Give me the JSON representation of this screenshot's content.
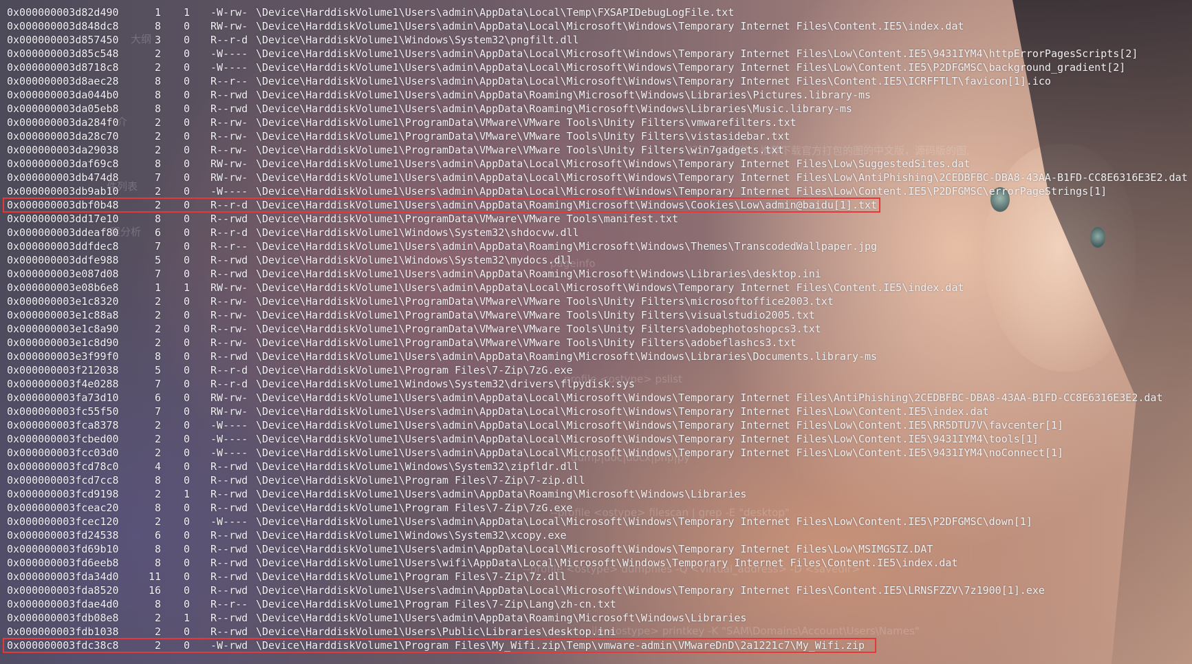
{
  "background_ghost_text": [
    "大纲",
    "介",
    "件列表",
    "程分析",
    "pageinfo",
    "行了一下安装，推荐下载官方打包的图的中文版，源码版的图,",
    "profile <ostype> pslist",
    "dump|doc|docx|php|py",
    "--profile <ostype> filescan | grep -E \"desktop\"",
    "--profile <ostype> dumpfiles -Q <virtual_address> -D <savedir>",
    "ile <ostype> printkey -K \"SAM\\Domains\\Account\\Users\\Names\""
  ],
  "rows": [
    {
      "off": "0x000000003d82d490",
      "ptr": "1",
      "hnd": "1",
      "acc": "-W-rw-",
      "path": "\\Device\\HarddiskVolume1\\Users\\admin\\AppData\\Local\\Temp\\FXSAPIDebugLogFile.txt"
    },
    {
      "off": "0x000000003d848dc8",
      "ptr": "8",
      "hnd": "0",
      "acc": "RW-rw-",
      "path": "\\Device\\HarddiskVolume1\\Users\\admin\\AppData\\Local\\Microsoft\\Windows\\Temporary Internet Files\\Content.IE5\\index.dat"
    },
    {
      "off": "0x000000003d857450",
      "ptr": "3",
      "hnd": "0",
      "acc": "R--r-d",
      "path": "\\Device\\HarddiskVolume1\\Windows\\System32\\pngfilt.dll"
    },
    {
      "off": "0x000000003d85c548",
      "ptr": "2",
      "hnd": "0",
      "acc": "-W----",
      "path": "\\Device\\HarddiskVolume1\\Users\\admin\\AppData\\Local\\Microsoft\\Windows\\Temporary Internet Files\\Low\\Content.IE5\\9431IYM4\\httpErrorPagesScripts[2]"
    },
    {
      "off": "0x000000003d8718c8",
      "ptr": "2",
      "hnd": "0",
      "acc": "-W----",
      "path": "\\Device\\HarddiskVolume1\\Users\\admin\\AppData\\Local\\Microsoft\\Windows\\Temporary Internet Files\\Low\\Content.IE5\\P2DFGMSC\\background_gradient[2]"
    },
    {
      "off": "0x000000003d8aec28",
      "ptr": "8",
      "hnd": "0",
      "acc": "R--r--",
      "path": "\\Device\\HarddiskVolume1\\Users\\admin\\AppData\\Local\\Microsoft\\Windows\\Temporary Internet Files\\Content.IE5\\ICRFFTLT\\favicon[1].ico"
    },
    {
      "off": "0x000000003da044b0",
      "ptr": "8",
      "hnd": "0",
      "acc": "R--rwd",
      "path": "\\Device\\HarddiskVolume1\\Users\\admin\\AppData\\Roaming\\Microsoft\\Windows\\Libraries\\Pictures.library-ms"
    },
    {
      "off": "0x000000003da05eb8",
      "ptr": "8",
      "hnd": "0",
      "acc": "R--rwd",
      "path": "\\Device\\HarddiskVolume1\\Users\\admin\\AppData\\Roaming\\Microsoft\\Windows\\Libraries\\Music.library-ms"
    },
    {
      "off": "0x000000003da284f0",
      "ptr": "2",
      "hnd": "0",
      "acc": "R--rw-",
      "path": "\\Device\\HarddiskVolume1\\ProgramData\\VMware\\VMware Tools\\Unity Filters\\vmwarefilters.txt"
    },
    {
      "off": "0x000000003da28c70",
      "ptr": "2",
      "hnd": "0",
      "acc": "R--rw-",
      "path": "\\Device\\HarddiskVolume1\\ProgramData\\VMware\\VMware Tools\\Unity Filters\\vistasidebar.txt"
    },
    {
      "off": "0x000000003da29038",
      "ptr": "2",
      "hnd": "0",
      "acc": "R--rw-",
      "path": "\\Device\\HarddiskVolume1\\ProgramData\\VMware\\VMware Tools\\Unity Filters\\win7gadgets.txt"
    },
    {
      "off": "0x000000003daf69c8",
      "ptr": "8",
      "hnd": "0",
      "acc": "RW-rw-",
      "path": "\\Device\\HarddiskVolume1\\Users\\admin\\AppData\\Local\\Microsoft\\Windows\\Temporary Internet Files\\Low\\SuggestedSites.dat"
    },
    {
      "off": "0x000000003db474d8",
      "ptr": "7",
      "hnd": "0",
      "acc": "RW-rw-",
      "path": "\\Device\\HarddiskVolume1\\Users\\admin\\AppData\\Local\\Microsoft\\Windows\\Temporary Internet Files\\Low\\AntiPhishing\\2CEDBFBC-DBA8-43AA-B1FD-CC8E6316E3E2.dat"
    },
    {
      "off": "0x000000003db9ab10",
      "ptr": "2",
      "hnd": "0",
      "acc": "-W----",
      "path": "\\Device\\HarddiskVolume1\\Users\\admin\\AppData\\Local\\Microsoft\\Windows\\Temporary Internet Files\\Low\\Content.IE5\\P2DFGMSC\\errorPageStrings[1]"
    },
    {
      "off": "0x000000003dbf0b48",
      "ptr": "2",
      "hnd": "0",
      "acc": "R--r-d",
      "path": "\\Device\\HarddiskVolume1\\Users\\admin\\AppData\\Roaming\\Microsoft\\Windows\\Cookies\\Low\\admin@baidu[1].txt",
      "highlight": true
    },
    {
      "off": "0x000000003dd17e10",
      "ptr": "8",
      "hnd": "0",
      "acc": "R--rwd",
      "path": "\\Device\\HarddiskVolume1\\ProgramData\\VMware\\VMware Tools\\manifest.txt"
    },
    {
      "off": "0x000000003ddeaf80",
      "ptr": "6",
      "hnd": "0",
      "acc": "R--r-d",
      "path": "\\Device\\HarddiskVolume1\\Windows\\System32\\shdocvw.dll"
    },
    {
      "off": "0x000000003ddfdec8",
      "ptr": "7",
      "hnd": "0",
      "acc": "R--r--",
      "path": "\\Device\\HarddiskVolume1\\Users\\admin\\AppData\\Roaming\\Microsoft\\Windows\\Themes\\TranscodedWallpaper.jpg"
    },
    {
      "off": "0x000000003ddfe988",
      "ptr": "5",
      "hnd": "0",
      "acc": "R--rwd",
      "path": "\\Device\\HarddiskVolume1\\Windows\\System32\\mydocs.dll"
    },
    {
      "off": "0x000000003e087d08",
      "ptr": "7",
      "hnd": "0",
      "acc": "R--rwd",
      "path": "\\Device\\HarddiskVolume1\\Users\\admin\\AppData\\Roaming\\Microsoft\\Windows\\Libraries\\desktop.ini"
    },
    {
      "off": "0x000000003e08b6e8",
      "ptr": "1",
      "hnd": "1",
      "acc": "RW-rw-",
      "path": "\\Device\\HarddiskVolume1\\Users\\admin\\AppData\\Local\\Microsoft\\Windows\\Temporary Internet Files\\Content.IE5\\index.dat"
    },
    {
      "off": "0x000000003e1c8320",
      "ptr": "2",
      "hnd": "0",
      "acc": "R--rw-",
      "path": "\\Device\\HarddiskVolume1\\ProgramData\\VMware\\VMware Tools\\Unity Filters\\microsoftoffice2003.txt"
    },
    {
      "off": "0x000000003e1c88a8",
      "ptr": "2",
      "hnd": "0",
      "acc": "R--rw-",
      "path": "\\Device\\HarddiskVolume1\\ProgramData\\VMware\\VMware Tools\\Unity Filters\\visualstudio2005.txt"
    },
    {
      "off": "0x000000003e1c8a90",
      "ptr": "2",
      "hnd": "0",
      "acc": "R--rw-",
      "path": "\\Device\\HarddiskVolume1\\ProgramData\\VMware\\VMware Tools\\Unity Filters\\adobephotoshopcs3.txt"
    },
    {
      "off": "0x000000003e1c8d90",
      "ptr": "2",
      "hnd": "0",
      "acc": "R--rw-",
      "path": "\\Device\\HarddiskVolume1\\ProgramData\\VMware\\VMware Tools\\Unity Filters\\adobeflashcs3.txt"
    },
    {
      "off": "0x000000003e3f99f0",
      "ptr": "8",
      "hnd": "0",
      "acc": "R--rwd",
      "path": "\\Device\\HarddiskVolume1\\Users\\admin\\AppData\\Roaming\\Microsoft\\Windows\\Libraries\\Documents.library-ms"
    },
    {
      "off": "0x000000003f212038",
      "ptr": "5",
      "hnd": "0",
      "acc": "R--r-d",
      "path": "\\Device\\HarddiskVolume1\\Program Files\\7-Zip\\7zG.exe"
    },
    {
      "off": "0x000000003f4e0288",
      "ptr": "7",
      "hnd": "0",
      "acc": "R--r-d",
      "path": "\\Device\\HarddiskVolume1\\Windows\\System32\\drivers\\flpydisk.sys"
    },
    {
      "off": "0x000000003fa73d10",
      "ptr": "6",
      "hnd": "0",
      "acc": "RW-rw-",
      "path": "\\Device\\HarddiskVolume1\\Users\\admin\\AppData\\Local\\Microsoft\\Windows\\Temporary Internet Files\\AntiPhishing\\2CEDBFBC-DBA8-43AA-B1FD-CC8E6316E3E2.dat"
    },
    {
      "off": "0x000000003fc55f50",
      "ptr": "7",
      "hnd": "0",
      "acc": "RW-rw-",
      "path": "\\Device\\HarddiskVolume1\\Users\\admin\\AppData\\Local\\Microsoft\\Windows\\Temporary Internet Files\\Low\\Content.IE5\\index.dat"
    },
    {
      "off": "0x000000003fca8378",
      "ptr": "2",
      "hnd": "0",
      "acc": "-W----",
      "path": "\\Device\\HarddiskVolume1\\Users\\admin\\AppData\\Local\\Microsoft\\Windows\\Temporary Internet Files\\Low\\Content.IE5\\RR5DTU7V\\favcenter[1]"
    },
    {
      "off": "0x000000003fcbed00",
      "ptr": "2",
      "hnd": "0",
      "acc": "-W----",
      "path": "\\Device\\HarddiskVolume1\\Users\\admin\\AppData\\Local\\Microsoft\\Windows\\Temporary Internet Files\\Low\\Content.IE5\\9431IYM4\\tools[1]"
    },
    {
      "off": "0x000000003fcc03d0",
      "ptr": "2",
      "hnd": "0",
      "acc": "-W----",
      "path": "\\Device\\HarddiskVolume1\\Users\\admin\\AppData\\Local\\Microsoft\\Windows\\Temporary Internet Files\\Low\\Content.IE5\\9431IYM4\\noConnect[1]"
    },
    {
      "off": "0x000000003fcd78c0",
      "ptr": "4",
      "hnd": "0",
      "acc": "R--rwd",
      "path": "\\Device\\HarddiskVolume1\\Windows\\System32\\zipfldr.dll"
    },
    {
      "off": "0x000000003fcd7cc8",
      "ptr": "8",
      "hnd": "0",
      "acc": "R--rwd",
      "path": "\\Device\\HarddiskVolume1\\Program Files\\7-Zip\\7-zip.dll"
    },
    {
      "off": "0x000000003fcd9198",
      "ptr": "2",
      "hnd": "1",
      "acc": "R--rwd",
      "path": "\\Device\\HarddiskVolume1\\Users\\admin\\AppData\\Roaming\\Microsoft\\Windows\\Libraries"
    },
    {
      "off": "0x000000003fceac20",
      "ptr": "8",
      "hnd": "0",
      "acc": "R--rwd",
      "path": "\\Device\\HarddiskVolume1\\Program Files\\7-Zip\\7zG.exe"
    },
    {
      "off": "0x000000003fcec120",
      "ptr": "2",
      "hnd": "0",
      "acc": "-W----",
      "path": "\\Device\\HarddiskVolume1\\Users\\admin\\AppData\\Local\\Microsoft\\Windows\\Temporary Internet Files\\Low\\Content.IE5\\P2DFGMSC\\down[1]"
    },
    {
      "off": "0x000000003fd24538",
      "ptr": "6",
      "hnd": "0",
      "acc": "R--rwd",
      "path": "\\Device\\HarddiskVolume1\\Windows\\System32\\xcopy.exe"
    },
    {
      "off": "0x000000003fd69b10",
      "ptr": "8",
      "hnd": "0",
      "acc": "R--rwd",
      "path": "\\Device\\HarddiskVolume1\\Users\\admin\\AppData\\Local\\Microsoft\\Windows\\Temporary Internet Files\\Low\\MSIMGSIZ.DAT"
    },
    {
      "off": "0x000000003fd6eeb8",
      "ptr": "8",
      "hnd": "0",
      "acc": "R--rwd",
      "path": "\\Device\\HarddiskVolume1\\Users\\wifi\\AppData\\Local\\Microsoft\\Windows\\Temporary Internet Files\\Content.IE5\\index.dat"
    },
    {
      "off": "0x000000003fda34d0",
      "ptr": "11",
      "hnd": "0",
      "acc": "R--rwd",
      "path": "\\Device\\HarddiskVolume1\\Program Files\\7-Zip\\7z.dll"
    },
    {
      "off": "0x000000003fda8520",
      "ptr": "16",
      "hnd": "0",
      "acc": "R--rwd",
      "path": "\\Device\\HarddiskVolume1\\Users\\admin\\AppData\\Local\\Microsoft\\Windows\\Temporary Internet Files\\Content.IE5\\LRNSFZZV\\7z1900[1].exe"
    },
    {
      "off": "0x000000003fdae4d0",
      "ptr": "8",
      "hnd": "0",
      "acc": "R--r--",
      "path": "\\Device\\HarddiskVolume1\\Program Files\\7-Zip\\Lang\\zh-cn.txt"
    },
    {
      "off": "0x000000003fdb08e8",
      "ptr": "2",
      "hnd": "1",
      "acc": "R--rwd",
      "path": "\\Device\\HarddiskVolume1\\Users\\admin\\AppData\\Roaming\\Microsoft\\Windows\\Libraries"
    },
    {
      "off": "0x000000003fdb1038",
      "ptr": "2",
      "hnd": "0",
      "acc": "R--rwd",
      "path": "\\Device\\HarddiskVolume1\\Users\\Public\\Libraries\\desktop.ini"
    },
    {
      "off": "0x000000003fdc38c8",
      "ptr": "2",
      "hnd": "0",
      "acc": "-W-rwd",
      "path": "\\Device\\HarddiskVolume1\\Program Files\\My_Wifi.zip\\Temp\\vmware-admin\\VMwareDnD\\2a1221c7\\My_Wifi.zip",
      "highlight": true
    }
  ],
  "highlight_color": "#e5383b"
}
